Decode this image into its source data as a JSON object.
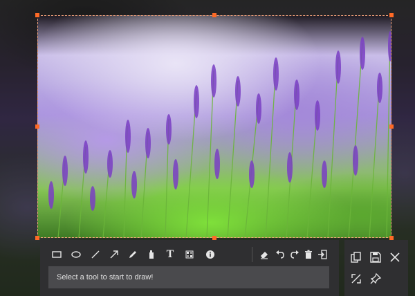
{
  "app": {
    "mode": "screen-capture-annotation"
  },
  "toolbar": {
    "tools": [
      {
        "name": "rectangle-tool",
        "icon": "rectangle-icon"
      },
      {
        "name": "ellipse-tool",
        "icon": "ellipse-icon"
      },
      {
        "name": "line-tool",
        "icon": "line-icon"
      },
      {
        "name": "arrow-tool",
        "icon": "arrow-icon"
      },
      {
        "name": "pen-tool",
        "icon": "pencil-icon"
      },
      {
        "name": "highlighter-tool",
        "icon": "marker-icon"
      },
      {
        "name": "text-tool",
        "icon": "text-icon",
        "glyph": "T"
      },
      {
        "name": "mosaic-tool",
        "icon": "mosaic-icon"
      },
      {
        "name": "callout-tool",
        "icon": "callout-icon"
      },
      {
        "name": "eraser-tool",
        "icon": "eraser-icon"
      },
      {
        "name": "undo-button",
        "icon": "undo-icon"
      },
      {
        "name": "redo-button",
        "icon": "redo-icon"
      },
      {
        "name": "delete-button",
        "icon": "trash-icon"
      },
      {
        "name": "exit-button",
        "icon": "exit-icon"
      }
    ],
    "hint_text": "Select a tool to start to draw!"
  },
  "side_panel": {
    "buttons": [
      {
        "name": "copy-button",
        "icon": "copy-icon"
      },
      {
        "name": "save-button",
        "icon": "save-icon"
      },
      {
        "name": "close-button",
        "icon": "close-icon"
      },
      {
        "name": "fullscreen-button",
        "icon": "expand-icon"
      },
      {
        "name": "pin-button",
        "icon": "pin-icon"
      }
    ]
  },
  "colors": {
    "selection_handle": "#ff6a26",
    "toolbar_bg": "#2f2f31",
    "hint_bg": "#4a4a4d",
    "icon": "#e6e6e6"
  }
}
